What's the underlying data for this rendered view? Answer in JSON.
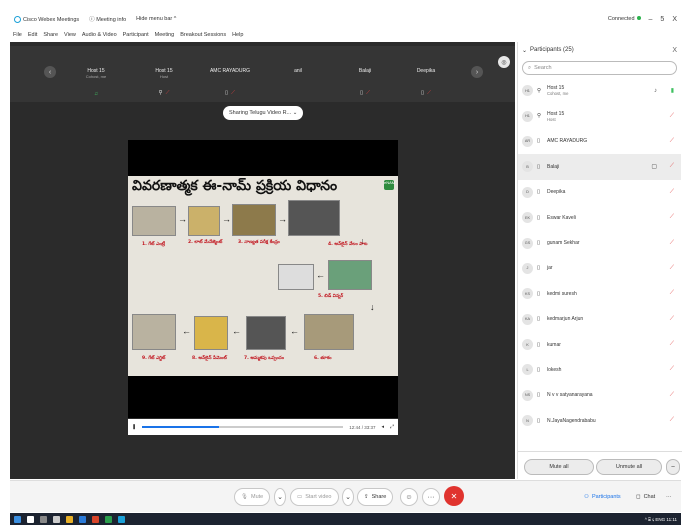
{
  "titlebar": {
    "app_name": "Cisco Webex Meetings",
    "meeting_info": "Meeting info",
    "hide_menu": "Hide menu bar ^",
    "status": "Connected",
    "win_min": "–",
    "win_max": "5",
    "win_close": "X"
  },
  "menu": [
    "File",
    "Edit",
    "Share",
    "View",
    "Audio & Video",
    "Participant",
    "Meeting",
    "Breakout Sessions",
    "Help"
  ],
  "strip": {
    "tiles": [
      {
        "name": "Host 15",
        "sub": "Cohost, me",
        "icon1": "♫",
        "icon2": ""
      },
      {
        "name": "Host 15",
        "sub": "Host",
        "icon1": "⚲",
        "icon2": "⟋"
      },
      {
        "name": "AMC RAYADURG",
        "sub": "",
        "icon1": "▯",
        "icon2": "⟋"
      },
      {
        "name": "anil",
        "sub": "",
        "icon1": "",
        "icon2": ""
      },
      {
        "name": "Balaji",
        "sub": "",
        "icon1": "▯",
        "icon2": "⟋"
      },
      {
        "name": "Deepika",
        "sub": "",
        "icon1": "▯",
        "icon2": "⟋"
      }
    ],
    "prev": "‹",
    "next": "›",
    "layout": "◎"
  },
  "share": {
    "label": "Sharing Telugu Video R... ⌄"
  },
  "video": {
    "slide_title": "వివరణాత్మక ఈ-నామ్ ప్రక్రియ విధానం",
    "logo_text": "eNAM",
    "steps": [
      "1. గేట్ ఎంట్రీ",
      "2. లాట్ మేనేజ్మెంట్",
      "3. నాణ్యత పరీక్ష కేంద్రం",
      "4. ఆన్‌లైన్ వేలం పాట",
      "5. బిడ్ విన్నర్",
      "6. తూకం",
      "7. అమ్మకపు ఒప్పందం",
      "8. ఆన్‌లైన్ పేమెంట్",
      "9. గేట్ ఎగ్జిట్"
    ],
    "time": "12:44 / 33:37",
    "progress_pct": 38
  },
  "bottom": {
    "mute": "Mute",
    "start_video": "Start video",
    "share": "Share",
    "emoji": "☺",
    "more": "···",
    "end": "✕",
    "participants": "Participants",
    "chat": "Chat",
    "overflow": "···"
  },
  "participants": {
    "title": "Participants (25)",
    "close": "X",
    "search_placeholder": "Search",
    "list": [
      {
        "initials": "H1",
        "name": "Host 15",
        "role": "Cohost, me",
        "mic": "on",
        "extra": "♪"
      },
      {
        "initials": "H1",
        "name": "Host 15",
        "role": "Host",
        "mic": "off",
        "extra": ""
      },
      {
        "initials": "AR",
        "name": "AMC RAYADURG",
        "role": "",
        "mic": "off",
        "extra": ""
      },
      {
        "initials": "B",
        "name": "Balaji",
        "role": "",
        "mic": "off",
        "extra": "▢"
      },
      {
        "initials": "D",
        "name": "Deepika",
        "role": "",
        "mic": "off",
        "extra": ""
      },
      {
        "initials": "EK",
        "name": "Eswar Kaveli",
        "role": "",
        "mic": "off",
        "extra": ""
      },
      {
        "initials": "GS",
        "name": "gunam Sekhar",
        "role": "",
        "mic": "off",
        "extra": ""
      },
      {
        "initials": "J",
        "name": "jar",
        "role": "",
        "mic": "off",
        "extra": ""
      },
      {
        "initials": "KS",
        "name": "kedmi suresh",
        "role": "",
        "mic": "off",
        "extra": ""
      },
      {
        "initials": "KA",
        "name": "kedmarjun Arjun",
        "role": "",
        "mic": "off",
        "extra": ""
      },
      {
        "initials": "K",
        "name": "kumar",
        "role": "",
        "mic": "off",
        "extra": ""
      },
      {
        "initials": "L",
        "name": "lokesh",
        "role": "",
        "mic": "off",
        "extra": ""
      },
      {
        "initials": "NS",
        "name": "N v v satyanarayana",
        "role": "",
        "mic": "off",
        "extra": ""
      },
      {
        "initials": "N",
        "name": "N.JayaNagendrababu",
        "role": "",
        "mic": "off",
        "extra": ""
      }
    ],
    "mute_all": "Mute all",
    "unmute_all": "Unmute all",
    "more": "–"
  },
  "taskbar": {
    "tray": "^ ⌸ ☇ ENG 11:11"
  },
  "colors": {
    "accent": "#1a73e8",
    "mic_off": "#e04040",
    "mic_on": "#3fc060",
    "end_call": "#e0332e",
    "connected_dot": "#2bb24c"
  }
}
